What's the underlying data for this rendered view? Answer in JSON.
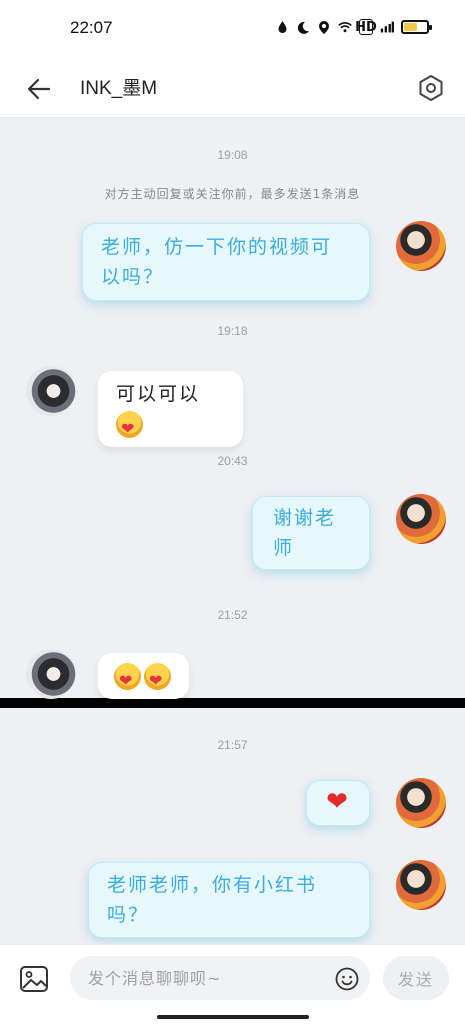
{
  "status_bar": {
    "time": "22:07",
    "icons": [
      "water-drop-icon",
      "moon-icon",
      "location-icon",
      "wifi-icon",
      "hd-icon",
      "signal-icon",
      "battery-icon"
    ],
    "hd_label": "HD",
    "battery_fraction": 0.6,
    "battery_color": "#f2c94c"
  },
  "header": {
    "title": "INK_墨M",
    "back_icon": "arrow-left-icon",
    "settings_icon": "hexagon-settings-icon"
  },
  "chat": {
    "background": "#eef0f3",
    "accent": "#3aaede",
    "items": [
      {
        "kind": "time",
        "text": "19:08"
      },
      {
        "kind": "notice",
        "text": "对方主动回复或关注你前，最多发送1条消息"
      },
      {
        "kind": "message",
        "from": "me",
        "text": "老师，仿一下你的视频可以吗？"
      },
      {
        "kind": "time",
        "text": "19:18"
      },
      {
        "kind": "message",
        "from": "peer",
        "text": "可以可以",
        "emoji": [
          "heart-hug-emoji"
        ]
      },
      {
        "kind": "time",
        "text": "20:43"
      },
      {
        "kind": "message",
        "from": "me",
        "text": "谢谢老师"
      },
      {
        "kind": "time",
        "text": "21:52"
      },
      {
        "kind": "message",
        "from": "peer",
        "text": "",
        "emoji": [
          "heart-hug-emoji",
          "heart-hug-emoji"
        ]
      },
      {
        "kind": "time",
        "text": "21:57"
      },
      {
        "kind": "message",
        "from": "me",
        "text": "❤"
      },
      {
        "kind": "message",
        "from": "me",
        "text": "老师老师，你有小红书吗？"
      }
    ]
  },
  "composer": {
    "image_icon": "image-icon",
    "placeholder": "发个消息聊聊呗~",
    "emoji_icon": "smiley-icon",
    "send_label": "发送"
  }
}
